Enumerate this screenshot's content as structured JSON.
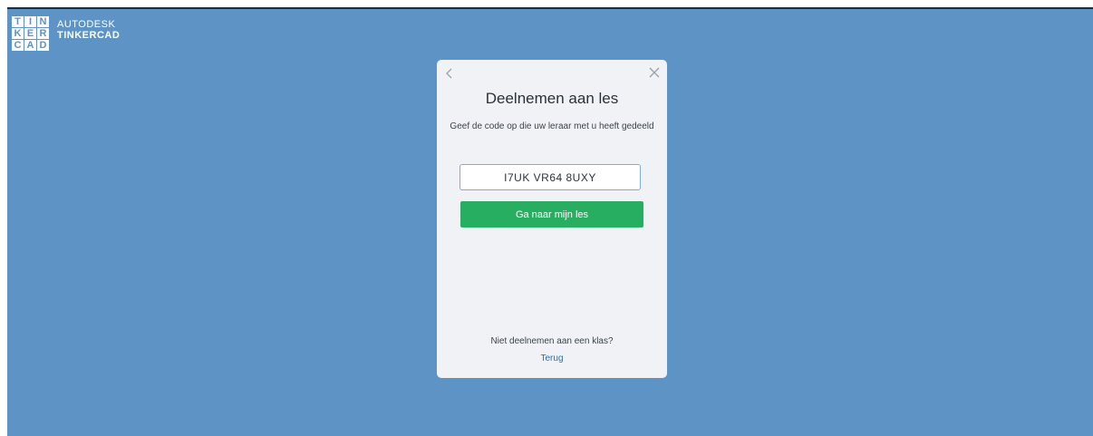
{
  "brand": {
    "logo_letters": [
      "T",
      "I",
      "N",
      "K",
      "E",
      "R",
      "C",
      "A",
      "D"
    ],
    "company": "AUTODESK",
    "product": "TINKERCAD",
    "background_color": "#5e93c6"
  },
  "modal": {
    "back_icon": "chevron-left-icon",
    "close_icon": "close-icon",
    "title": "Deelnemen aan les",
    "description": "Geef de code op die uw leraar met u heeft gedeeld",
    "code_input": {
      "value": "I7UK VR64 8UXY",
      "border_color": "#7eaee0"
    },
    "submit_label": "Ga naar mijn les",
    "submit_color": "#27ae60",
    "footer_prompt": "Niet deelnemen aan een klas?",
    "footer_link": "Terug"
  }
}
